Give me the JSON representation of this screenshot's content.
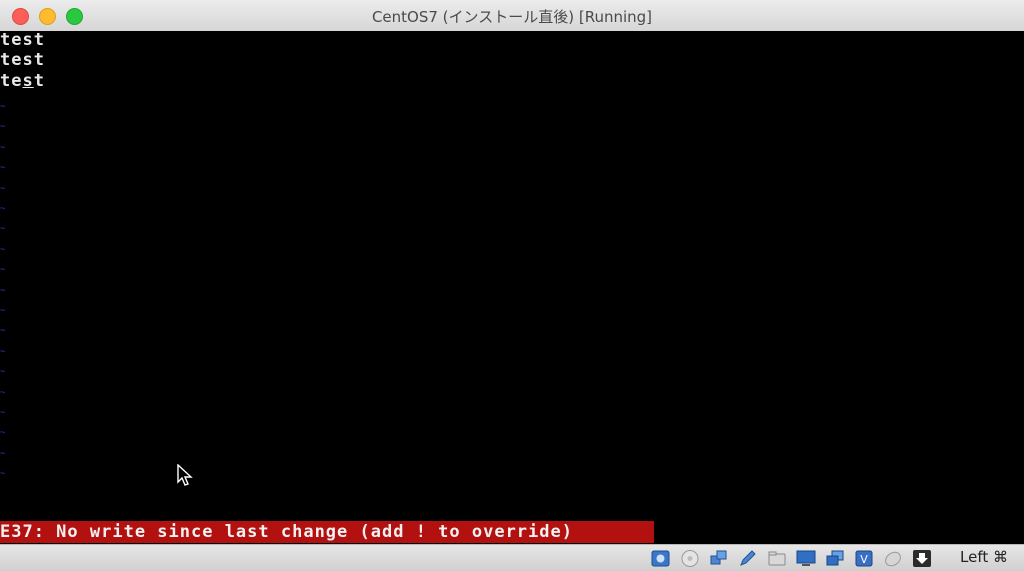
{
  "window": {
    "title": "CentOS7 (インストール直後) [Running]"
  },
  "terminal": {
    "lines": [
      "test",
      "test",
      "test"
    ],
    "error_message": "E37: No write since last change (add ! to override)"
  },
  "statusbar": {
    "icons": [
      "hard-disk-icon",
      "optical-drive-icon",
      "network-icon",
      "pencil-icon",
      "shared-folder-icon",
      "display-icon",
      "multi-screen-icon",
      "usb-icon",
      "mouse-integration-icon",
      "download-icon"
    ],
    "host_key": "Left ⌘"
  },
  "colors": {
    "error_bg": "#b31010",
    "tilde": "#2a3bd6",
    "text": "#e8e8e8"
  }
}
